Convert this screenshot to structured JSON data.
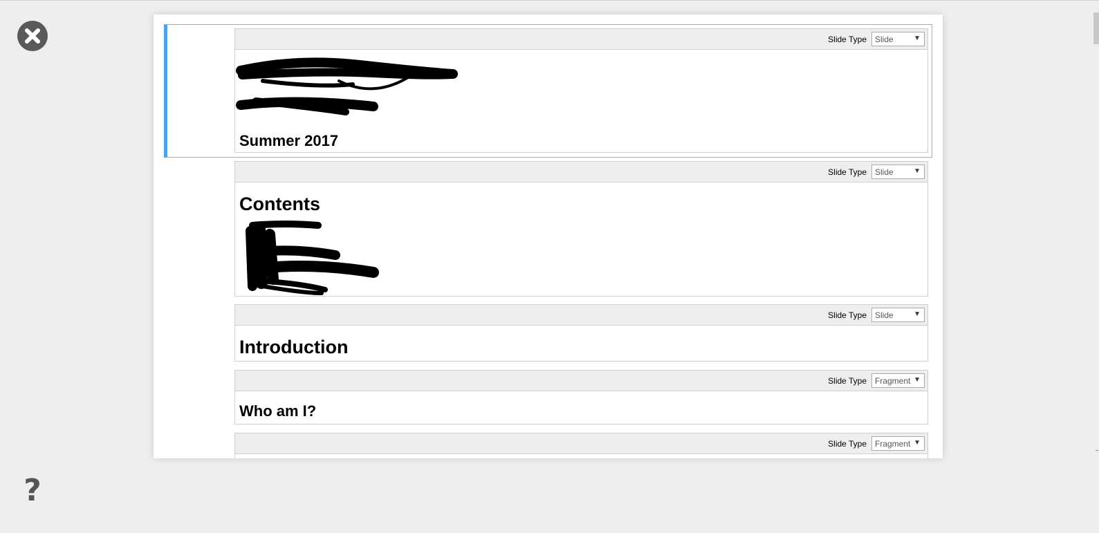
{
  "controls": {
    "close_icon": "close-icon",
    "help_icon": "question-icon",
    "help_label": "?"
  },
  "cells": [
    {
      "slide_type_label": "Slide Type",
      "slide_type": "Slide",
      "text": "Summer 2017",
      "redacted": true
    },
    {
      "slide_type_label": "Slide Type",
      "slide_type": "Slide",
      "heading": "Contents",
      "redacted": true
    },
    {
      "slide_type_label": "Slide Type",
      "slide_type": "Slide",
      "heading": "Introduction"
    },
    {
      "slide_type_label": "Slide Type",
      "slide_type": "Fragment",
      "heading": "Who am I?"
    },
    {
      "slide_type_label": "Slide Type",
      "slide_type": "Fragment"
    }
  ],
  "colors": {
    "selected_bar": "#42a5f5",
    "toolbar_bg": "#eeeeee",
    "page_bg": "#eeeeee"
  }
}
